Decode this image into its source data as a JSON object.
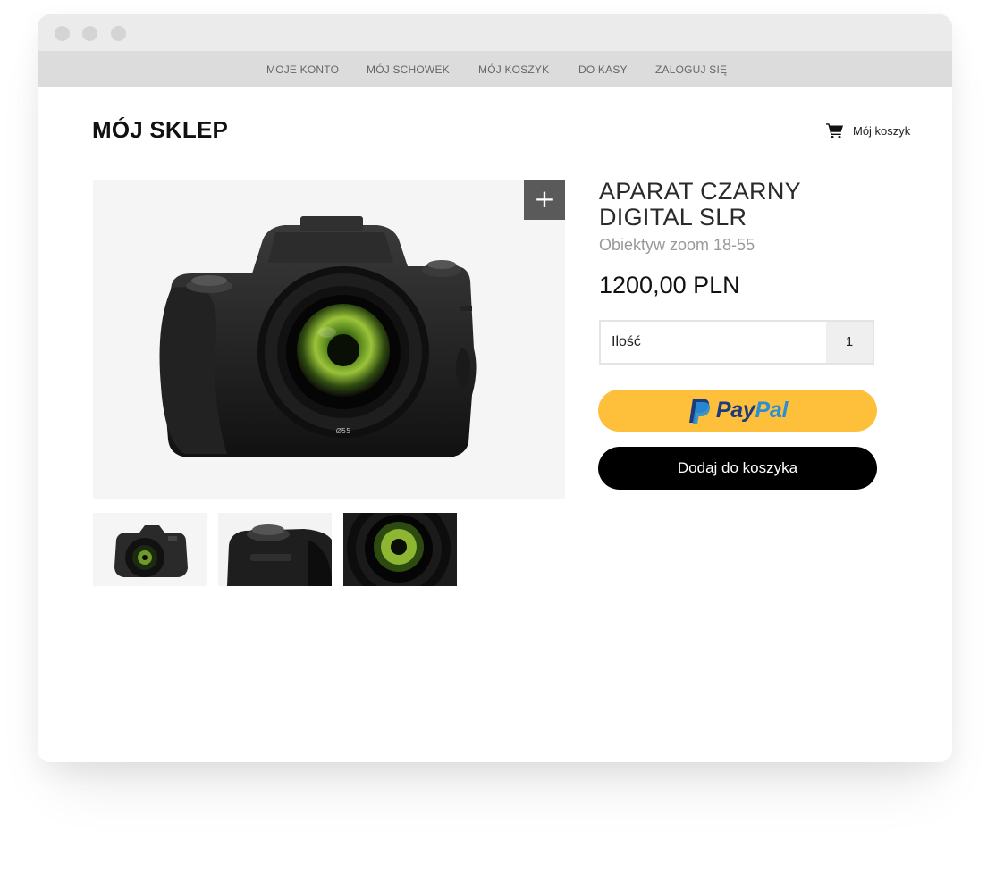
{
  "nav": {
    "items": [
      {
        "label": "MOJE KONTO"
      },
      {
        "label": "MÓJ SCHOWEK"
      },
      {
        "label": "MÓJ KOSZYK"
      },
      {
        "label": "DO KASY"
      },
      {
        "label": "ZALOGUJ SIĘ"
      }
    ]
  },
  "header": {
    "shop_title": "MÓJ SKLEP",
    "cart_label": "Mój koszyk",
    "cart_icon": "shopping-cart-icon"
  },
  "gallery": {
    "zoom_icon": "plus-icon",
    "zoom_label": "+",
    "main_image": "black-dslr-camera-image",
    "thumbnails": [
      {
        "image": "compact-camera-image"
      },
      {
        "image": "camera-grip-closeup-image"
      },
      {
        "image": "camera-lens-closeup-image"
      }
    ]
  },
  "product": {
    "title": "APARAT CZARNY DIGITAL SLR",
    "subtitle": "Obiektyw zoom 18-55",
    "price": "1200,00 PLN",
    "quantity_label": "Ilość",
    "quantity_value": "1"
  },
  "actions": {
    "paypal_word_1": "Pay",
    "paypal_word_2": "Pal",
    "paypal_icon": "paypal-logo-icon",
    "add_to_cart_label": "Dodaj do koszyka"
  },
  "colors": {
    "paypal_yellow": "#fec03a",
    "paypal_dark_blue": "#1b3a80",
    "paypal_light_blue": "#2a8fd6",
    "button_black": "#000000"
  }
}
